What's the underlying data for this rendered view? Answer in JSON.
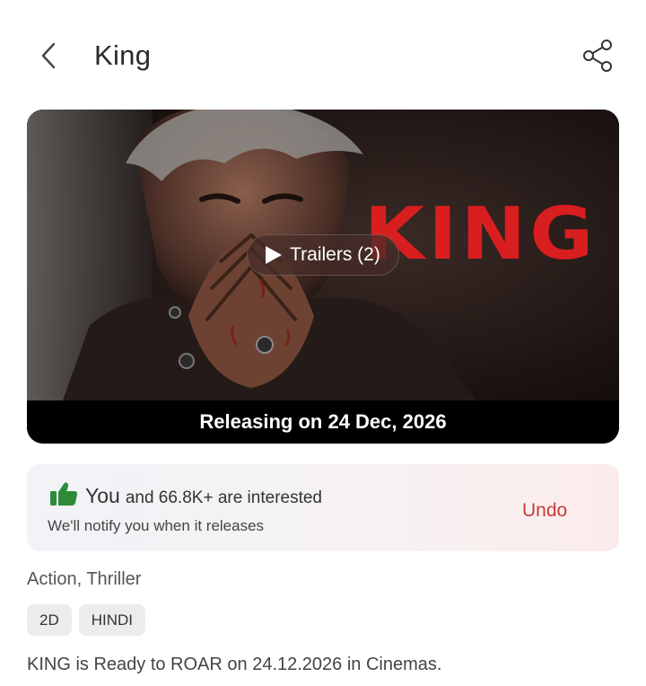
{
  "header": {
    "title": "King",
    "back_icon": "chevron-left-icon",
    "share_icon": "share-icon"
  },
  "poster": {
    "logo_text": "KING",
    "trailer_label": "Trailers (2)",
    "release_text": "Releasing on 24 Dec, 2026",
    "logo_color": "#d81e1e"
  },
  "interest": {
    "you_label": "You",
    "interest_text": "and 66.8K+  are interested",
    "notify_text": "We'll notify you when it releases",
    "undo_label": "Undo",
    "thumb_color": "#2e8b3a",
    "undo_color": "#c93b3b"
  },
  "details": {
    "genres": "Action, Thriller",
    "tags": [
      "2D",
      "HINDI"
    ],
    "description": "KING is Ready to ROAR on 24.12.2026 in Cinemas."
  }
}
